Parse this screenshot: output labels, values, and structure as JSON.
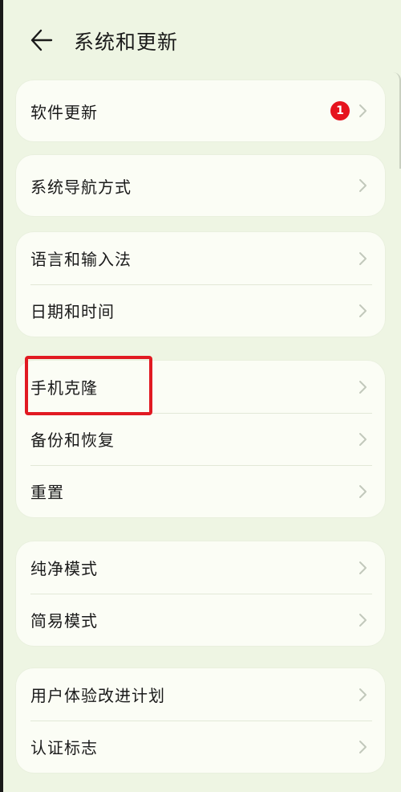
{
  "header": {
    "title": "系统和更新"
  },
  "groups": [
    {
      "items": [
        {
          "label": "软件更新",
          "badge": "1"
        }
      ]
    },
    {
      "items": [
        {
          "label": "系统导航方式"
        }
      ]
    },
    {
      "items": [
        {
          "label": "语言和输入法"
        },
        {
          "label": "日期和时间"
        }
      ]
    },
    {
      "items": [
        {
          "label": "手机克隆"
        },
        {
          "label": "备份和恢复"
        },
        {
          "label": "重置"
        }
      ]
    },
    {
      "items": [
        {
          "label": "纯净模式"
        },
        {
          "label": "简易模式"
        }
      ]
    },
    {
      "items": [
        {
          "label": "用户体验改进计划"
        },
        {
          "label": "认证标志"
        }
      ]
    }
  ],
  "colors": {
    "background": "#eef5e3",
    "card": "#fbfdf5",
    "badge": "#e6141e",
    "highlight": "#e11a22"
  }
}
